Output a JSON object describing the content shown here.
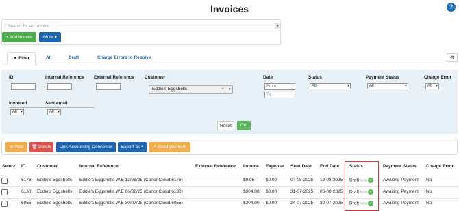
{
  "page": {
    "title": "Invoices",
    "help_icon": "question-icon"
  },
  "search": {
    "placeholder": "Search for an Invoice"
  },
  "toolbar": {
    "add_label": "+ Add Invoice",
    "more_label": "More ▾"
  },
  "tabs": [
    {
      "label": "Filter",
      "active": true
    },
    {
      "label": "All"
    },
    {
      "label": "Draft"
    },
    {
      "label": "Charge Errors to Resolve"
    }
  ],
  "filters": {
    "id_label": "ID",
    "internal_ref_label": "Internal Reference",
    "external_ref_label": "External Reference",
    "customer_label": "Customer",
    "customer_value": "Eddie's Eggshells",
    "date_label": "Date",
    "date_from_placeholder": "From",
    "date_to_placeholder": "To",
    "status_label": "Status",
    "status_value": "All",
    "payment_status_label": "Payment Status",
    "payment_status_value": "All",
    "charge_error_label": "Charge Error",
    "charge_error_value": "All",
    "invoiced_label": "Invoiced",
    "invoiced_value": "All",
    "sent_email_label": "Sent email",
    "sent_email_value": "All",
    "reset_label": "Reset",
    "go_label": "Go!"
  },
  "actions": {
    "void_label": "⊘ Void",
    "delete_label": "🗑 Delete",
    "link_label": "Link Accounting Connector",
    "export_label": "Export as ▾",
    "send_label": "⚡ Send payment"
  },
  "table": {
    "columns": [
      "Select",
      "ID",
      "Customer",
      "Internal Reference",
      "External Reference",
      "Income",
      "Expense",
      "Start Date",
      "End Date",
      "Status",
      "Payment Status",
      "Charge Error"
    ],
    "rows": [
      {
        "id": "6176",
        "customer": "Eddie's Eggshells",
        "internal_ref": "Eddie's Eggshells W.E 13/08/25 (CartonCloud:6176)",
        "external_ref": "",
        "income": "$9.05",
        "expense": "$0.00",
        "start": "07-08-2025",
        "end": "13-08-2025",
        "status": "Draft",
        "status_tag": "NEW",
        "payment_status": "Awaiting Payment",
        "charge_error": "No"
      },
      {
        "id": "6130",
        "customer": "Eddie's Eggshells",
        "internal_ref": "Eddie's Eggshells W.E 06/08/25 (CartonCloud:6130)",
        "external_ref": "",
        "income": "$304.00",
        "expense": "$0.00",
        "start": "31-07-2025",
        "end": "06-08-2025",
        "status": "Draft",
        "status_tag": "NEW",
        "payment_status": "Awaiting Payment",
        "charge_error": "No"
      },
      {
        "id": "6055",
        "customer": "Eddie's Eggshells",
        "internal_ref": "Eddie's Eggshells W.E 30/07/25 (CartonCloud:6055)",
        "external_ref": "",
        "income": "$304.00",
        "expense": "$0.00",
        "start": "24-07-2025",
        "end": "30-07-2025",
        "status": "Draft",
        "status_tag": "NEW",
        "payment_status": "Awaiting Payment",
        "charge_error": "No"
      }
    ]
  },
  "colors": {
    "primary": "#1d64ae",
    "success": "#5cb85c",
    "danger": "#d9534f",
    "warning": "#f0ad4e",
    "highlight": "#dd3333"
  }
}
